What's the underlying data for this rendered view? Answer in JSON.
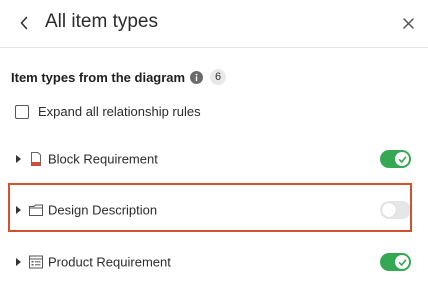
{
  "header": {
    "title": "All item types",
    "back_icon": "chevron-left-icon",
    "close_icon": "close-icon"
  },
  "section": {
    "title": "Item types from the diagram",
    "count": "6",
    "info_icon": "info-icon"
  },
  "expand_all": {
    "label": "Expand all relationship rules",
    "checked": false
  },
  "item_types": [
    {
      "label": "Block Requirement",
      "icon": "block-requirement-icon",
      "enabled": true
    },
    {
      "label": "Design Description",
      "icon": "design-description-icon",
      "enabled": false
    },
    {
      "label": "Product Requirement",
      "icon": "product-requirement-icon",
      "enabled": true
    }
  ],
  "colors": {
    "toggle_on": "#34a853",
    "toggle_off": "#e6e6e6",
    "highlight": "#d2522c"
  }
}
